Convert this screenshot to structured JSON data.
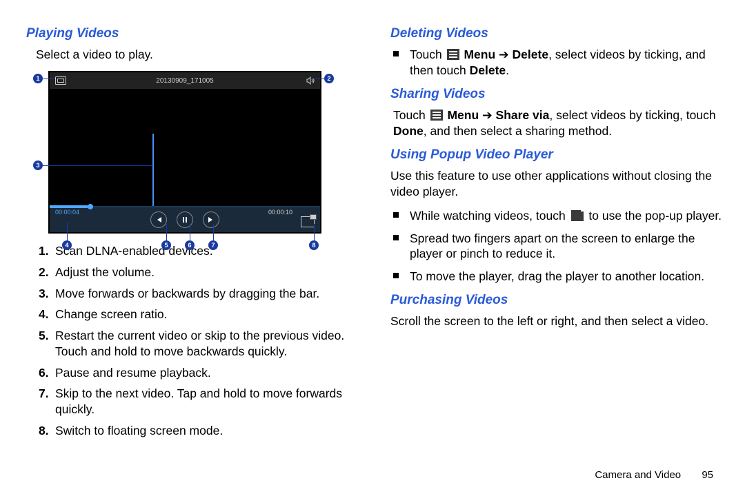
{
  "left": {
    "heading": "Playing Videos",
    "intro": "Select a video to play.",
    "player": {
      "title_text": "20130909_171005",
      "time_elapsed": "00:00:04",
      "time_total": "00:00:10"
    },
    "callouts": [
      "1",
      "2",
      "3",
      "4",
      "5",
      "6",
      "7",
      "8"
    ],
    "steps": [
      {
        "n": "1.",
        "t": "Scan DLNA-enabled devices."
      },
      {
        "n": "2.",
        "t": "Adjust the volume."
      },
      {
        "n": "3.",
        "t": "Move forwards or backwards by dragging the bar."
      },
      {
        "n": "4.",
        "t": "Change screen ratio."
      },
      {
        "n": "5.",
        "t": "Restart the current video or skip to the previous video. Touch and hold to move backwards quickly."
      },
      {
        "n": "6.",
        "t": "Pause and resume playback."
      },
      {
        "n": "7.",
        "t": "Skip to the next video. Tap and hold to move forwards quickly."
      },
      {
        "n": "8.",
        "t": "Switch to floating screen mode."
      }
    ]
  },
  "right": {
    "s1": {
      "heading": "Deleting Videos",
      "bullet_pre": "Touch ",
      "bullet_menu": "Menu",
      "bullet_arrow": " ➔ ",
      "bullet_del": "Delete",
      "bullet_mid": ", select videos by ticking, and then touch ",
      "bullet_del2": "Delete",
      "bullet_end": "."
    },
    "s2": {
      "heading": "Sharing Videos",
      "p_pre": "Touch ",
      "p_menu": "Menu",
      "p_arrow": " ➔ ",
      "p_share": "Share via",
      "p_mid": ", select videos by ticking, touch ",
      "p_done": "Done",
      "p_end": ", and then select a sharing method."
    },
    "s3": {
      "heading": "Using Popup Video Player",
      "intro": "Use this feature to use other applications without closing the video player.",
      "b1_pre": "While watching videos, touch ",
      "b1_post": " to use the pop-up player.",
      "b2": "Spread two fingers apart on the screen to enlarge the player or pinch to reduce it.",
      "b3": "To move the player, drag the player to another location."
    },
    "s4": {
      "heading": "Purchasing Videos",
      "p": "Scroll the screen to the left or right, and then select a video."
    }
  },
  "footer": {
    "section": "Camera and Video",
    "page": "95"
  }
}
